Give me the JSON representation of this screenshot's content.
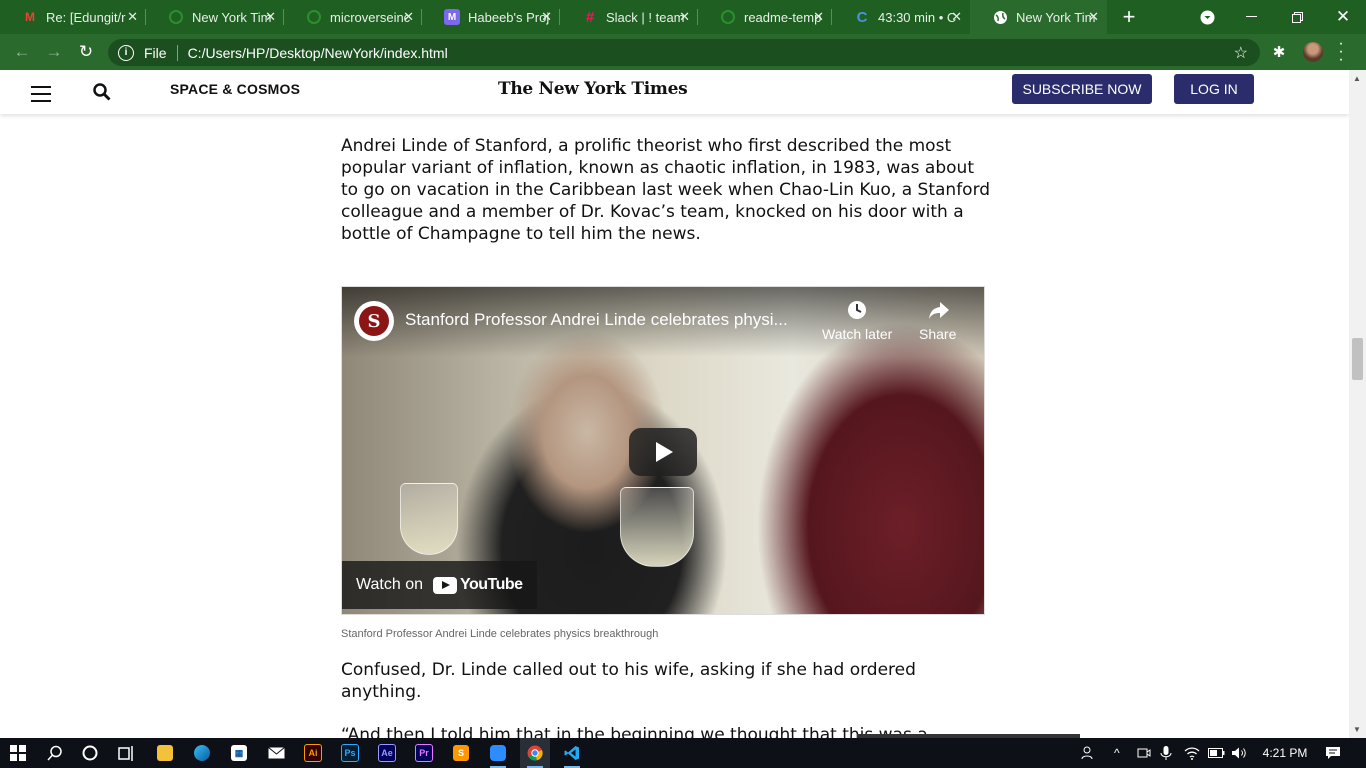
{
  "browser": {
    "tabs": [
      {
        "title": "Re: [Edungit/r",
        "icon": "gmail-icon",
        "color": "#ea4335",
        "glyph": "M"
      },
      {
        "title": "New York Tim",
        "icon": "github-icon",
        "color": "#ffffff",
        "glyph": ""
      },
      {
        "title": "microverseinc",
        "icon": "github-icon",
        "color": "#ffffff",
        "glyph": ""
      },
      {
        "title": "Habeeb's Proj",
        "icon": "app-icon",
        "color": "#7b68ee",
        "glyph": "M"
      },
      {
        "title": "Slack | ! team",
        "icon": "slack-icon",
        "color": "#e01e5a",
        "glyph": "#"
      },
      {
        "title": "readme-temp",
        "icon": "github-icon",
        "color": "#ffffff",
        "glyph": ""
      },
      {
        "title": "43:30 min • C",
        "icon": "timer-icon",
        "color": "#4a90e2",
        "glyph": "C"
      },
      {
        "title": "New York Tim",
        "icon": "globe-icon",
        "color": "#ffffff",
        "glyph": ""
      }
    ],
    "active_tab": 7,
    "new_tab": "+",
    "scheme_label": "File",
    "url": "C:/Users/HP/Desktop/NewYork/index.html"
  },
  "site": {
    "section": "SPACE & COSMOS",
    "logo": "The New York Times",
    "subscribe": "SUBSCRIBE NOW",
    "login": "LOG IN"
  },
  "article": {
    "para1": "Andrei Linde of Stanford, a prolific theorist who first described the most popular variant of inflation, known as chaotic inflation, in 1983, was about to go on vacation in the Caribbean last week when Chao-Lin Kuo, a Stanford colleague and a member of Dr. Kovac’s team, knocked on his door with a bottle of Champagne to tell him the news.",
    "video": {
      "title": "Stanford Professor Andrei Linde celebrates physi...",
      "watch_later": "Watch later",
      "share": "Share",
      "watch_on": "Watch on",
      "youtube": "YouTube",
      "channel_glyph": "S"
    },
    "caption": "Stanford Professor Andrei Linde celebrates physics breakthrough",
    "para2": "Confused, Dr. Linde called out to his wife, asking if she had ordered anything.",
    "para3": "“And then I told him that in the beginning we thought that this was a"
  },
  "taskbar": {
    "apps": [
      "start-icon",
      "search-icon",
      "cortana-icon",
      "task-view-icon",
      "file-explorer-icon",
      "edge-icon",
      "store-icon",
      "mail-icon",
      "illustrator-icon",
      "photoshop-icon",
      "after-effects-icon",
      "premiere-icon",
      "sublime-icon",
      "zoom-icon",
      "chrome-icon",
      "vscode-icon"
    ],
    "app_labels": {
      "ai": "Ai",
      "ps": "Ps",
      "ae": "Ae",
      "pr": "Pr"
    },
    "time": "4:21 PM"
  }
}
